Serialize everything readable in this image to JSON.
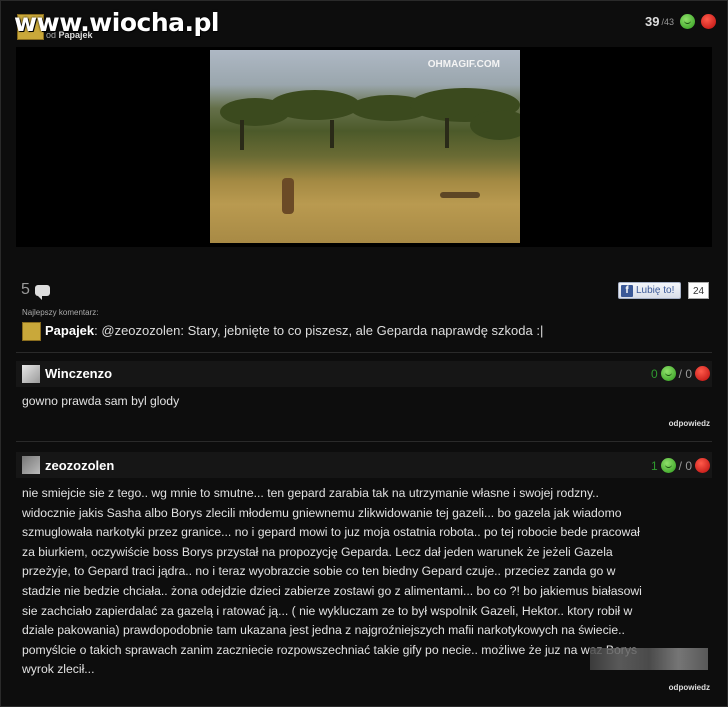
{
  "watermark": "www.wiocha.pl",
  "post": {
    "title": "",
    "author_prefix": "od",
    "author": "Papajek",
    "votes_up": "39",
    "votes_total": "/43",
    "gif_logo": "OHMAGIF.COM"
  },
  "comments_meta": {
    "count": "5",
    "like_label": "Lubię to!",
    "like_count": "24",
    "best_label": "Najlepszy komentarz:"
  },
  "best_comment": {
    "author": "Papajek",
    "text": ": @zeozozolen: Stary, jebnięte to co piszesz, ale Geparda naprawdę szkoda :|"
  },
  "comments": [
    {
      "author": "Winczenzo",
      "plus": "0",
      "minus": "/ 0",
      "text": "gowno prawda sam byl glody",
      "reply": "odpowiedz"
    },
    {
      "author": "zeozozolen",
      "plus": "1",
      "minus": "/ 0",
      "lines": [
        "nie smiejcie sie z tego.. wg mnie to smutne... ten gepard zarabia tak na utrzymanie własne i swojej rodzny..",
        "widocznie jakis Sasha albo Borys zlecili młodemu gniewnemu zlikwidowanie tej gazeli... bo gazela jak wiadomo",
        "szmuglowała narkotyki przez granice... no i gepard mowi to juz moja ostatnia robota.. po tej robocie bede pracował",
        "za biurkiem, oczywiście boss Borys przystał na propozycję Geparda. Lecz dał jeden warunek że jeżeli Gazela",
        "przeżyje, to Gepard traci jądra.. no i teraz wyobrazcie sobie co ten biedny Gepard czuje.. przeciez zanda go w",
        "stadzie nie bedzie chciała.. żona odejdzie dzieci zabierze zostawi go z alimentami... bo co ?! bo jakiemus białasowi",
        "sie zachciało zapierdalać za gazelą i ratować ją... ( nie wykluczam ze to był wspolnik Gazeli, Hektor.. ktory robił w",
        "dziale pakowania) prawdopodobnie tam ukazana jest jedna z najgroźniejszych mafii narkotykowych na świecie..",
        "pomyślcie o takich sprawach zanim zaczniecie rozpowszechniać takie gify po necie.. możliwe że juz na waz Borys",
        "wyrok zlecił..."
      ],
      "reply": "odpowiedz"
    }
  ]
}
